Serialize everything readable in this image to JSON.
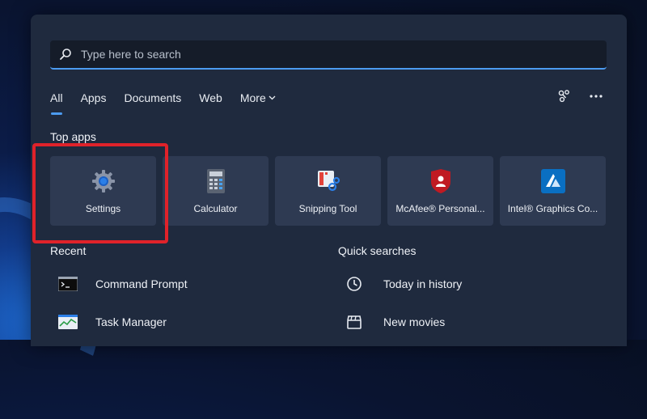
{
  "search": {
    "placeholder": "Type here to search"
  },
  "tabs": [
    {
      "label": "All"
    },
    {
      "label": "Apps"
    },
    {
      "label": "Documents"
    },
    {
      "label": "Web"
    },
    {
      "label": "More"
    }
  ],
  "tab_icons": [
    "share-icon",
    "more-options-icon"
  ],
  "top_apps": {
    "title": "Top apps",
    "items": [
      {
        "label": "Settings",
        "icon": "gear-icon"
      },
      {
        "label": "Calculator",
        "icon": "calculator-icon"
      },
      {
        "label": "Snipping Tool",
        "icon": "snipping-tool-icon"
      },
      {
        "label": "McAfee® Personal...",
        "icon": "mcafee-icon"
      },
      {
        "label": "Intel® Graphics Co...",
        "icon": "intel-graphics-icon"
      }
    ]
  },
  "recent": {
    "title": "Recent",
    "items": [
      {
        "label": "Command Prompt",
        "icon": "command-prompt-icon"
      },
      {
        "label": "Task Manager",
        "icon": "task-manager-icon"
      }
    ]
  },
  "quick_searches": {
    "title": "Quick searches",
    "items": [
      {
        "label": "Today in history",
        "icon": "clock-icon"
      },
      {
        "label": "New movies",
        "icon": "clapperboard-icon"
      }
    ]
  },
  "colors": {
    "accent": "#4c9bf0",
    "highlight": "#e0222a",
    "panel": "#1f2a3e",
    "tile": "#2e3a52"
  }
}
